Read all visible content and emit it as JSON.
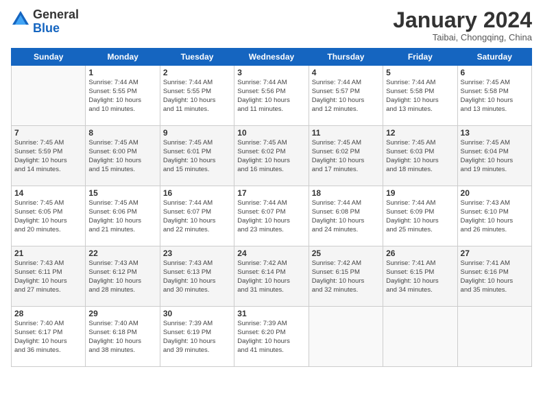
{
  "logo": {
    "general": "General",
    "blue": "Blue"
  },
  "title": "January 2024",
  "subtitle": "Taibai, Chongqing, China",
  "headers": [
    "Sunday",
    "Monday",
    "Tuesday",
    "Wednesday",
    "Thursday",
    "Friday",
    "Saturday"
  ],
  "weeks": [
    [
      {
        "date": "",
        "info": ""
      },
      {
        "date": "1",
        "info": "Sunrise: 7:44 AM\nSunset: 5:55 PM\nDaylight: 10 hours\nand 10 minutes."
      },
      {
        "date": "2",
        "info": "Sunrise: 7:44 AM\nSunset: 5:55 PM\nDaylight: 10 hours\nand 11 minutes."
      },
      {
        "date": "3",
        "info": "Sunrise: 7:44 AM\nSunset: 5:56 PM\nDaylight: 10 hours\nand 11 minutes."
      },
      {
        "date": "4",
        "info": "Sunrise: 7:44 AM\nSunset: 5:57 PM\nDaylight: 10 hours\nand 12 minutes."
      },
      {
        "date": "5",
        "info": "Sunrise: 7:44 AM\nSunset: 5:58 PM\nDaylight: 10 hours\nand 13 minutes."
      },
      {
        "date": "6",
        "info": "Sunrise: 7:45 AM\nSunset: 5:58 PM\nDaylight: 10 hours\nand 13 minutes."
      }
    ],
    [
      {
        "date": "7",
        "info": "Sunrise: 7:45 AM\nSunset: 5:59 PM\nDaylight: 10 hours\nand 14 minutes."
      },
      {
        "date": "8",
        "info": "Sunrise: 7:45 AM\nSunset: 6:00 PM\nDaylight: 10 hours\nand 15 minutes."
      },
      {
        "date": "9",
        "info": "Sunrise: 7:45 AM\nSunset: 6:01 PM\nDaylight: 10 hours\nand 15 minutes."
      },
      {
        "date": "10",
        "info": "Sunrise: 7:45 AM\nSunset: 6:02 PM\nDaylight: 10 hours\nand 16 minutes."
      },
      {
        "date": "11",
        "info": "Sunrise: 7:45 AM\nSunset: 6:02 PM\nDaylight: 10 hours\nand 17 minutes."
      },
      {
        "date": "12",
        "info": "Sunrise: 7:45 AM\nSunset: 6:03 PM\nDaylight: 10 hours\nand 18 minutes."
      },
      {
        "date": "13",
        "info": "Sunrise: 7:45 AM\nSunset: 6:04 PM\nDaylight: 10 hours\nand 19 minutes."
      }
    ],
    [
      {
        "date": "14",
        "info": "Sunrise: 7:45 AM\nSunset: 6:05 PM\nDaylight: 10 hours\nand 20 minutes."
      },
      {
        "date": "15",
        "info": "Sunrise: 7:45 AM\nSunset: 6:06 PM\nDaylight: 10 hours\nand 21 minutes."
      },
      {
        "date": "16",
        "info": "Sunrise: 7:44 AM\nSunset: 6:07 PM\nDaylight: 10 hours\nand 22 minutes."
      },
      {
        "date": "17",
        "info": "Sunrise: 7:44 AM\nSunset: 6:07 PM\nDaylight: 10 hours\nand 23 minutes."
      },
      {
        "date": "18",
        "info": "Sunrise: 7:44 AM\nSunset: 6:08 PM\nDaylight: 10 hours\nand 24 minutes."
      },
      {
        "date": "19",
        "info": "Sunrise: 7:44 AM\nSunset: 6:09 PM\nDaylight: 10 hours\nand 25 minutes."
      },
      {
        "date": "20",
        "info": "Sunrise: 7:43 AM\nSunset: 6:10 PM\nDaylight: 10 hours\nand 26 minutes."
      }
    ],
    [
      {
        "date": "21",
        "info": "Sunrise: 7:43 AM\nSunset: 6:11 PM\nDaylight: 10 hours\nand 27 minutes."
      },
      {
        "date": "22",
        "info": "Sunrise: 7:43 AM\nSunset: 6:12 PM\nDaylight: 10 hours\nand 28 minutes."
      },
      {
        "date": "23",
        "info": "Sunrise: 7:43 AM\nSunset: 6:13 PM\nDaylight: 10 hours\nand 30 minutes."
      },
      {
        "date": "24",
        "info": "Sunrise: 7:42 AM\nSunset: 6:14 PM\nDaylight: 10 hours\nand 31 minutes."
      },
      {
        "date": "25",
        "info": "Sunrise: 7:42 AM\nSunset: 6:15 PM\nDaylight: 10 hours\nand 32 minutes."
      },
      {
        "date": "26",
        "info": "Sunrise: 7:41 AM\nSunset: 6:15 PM\nDaylight: 10 hours\nand 34 minutes."
      },
      {
        "date": "27",
        "info": "Sunrise: 7:41 AM\nSunset: 6:16 PM\nDaylight: 10 hours\nand 35 minutes."
      }
    ],
    [
      {
        "date": "28",
        "info": "Sunrise: 7:40 AM\nSunset: 6:17 PM\nDaylight: 10 hours\nand 36 minutes."
      },
      {
        "date": "29",
        "info": "Sunrise: 7:40 AM\nSunset: 6:18 PM\nDaylight: 10 hours\nand 38 minutes."
      },
      {
        "date": "30",
        "info": "Sunrise: 7:39 AM\nSunset: 6:19 PM\nDaylight: 10 hours\nand 39 minutes."
      },
      {
        "date": "31",
        "info": "Sunrise: 7:39 AM\nSunset: 6:20 PM\nDaylight: 10 hours\nand 41 minutes."
      },
      {
        "date": "",
        "info": ""
      },
      {
        "date": "",
        "info": ""
      },
      {
        "date": "",
        "info": ""
      }
    ]
  ]
}
